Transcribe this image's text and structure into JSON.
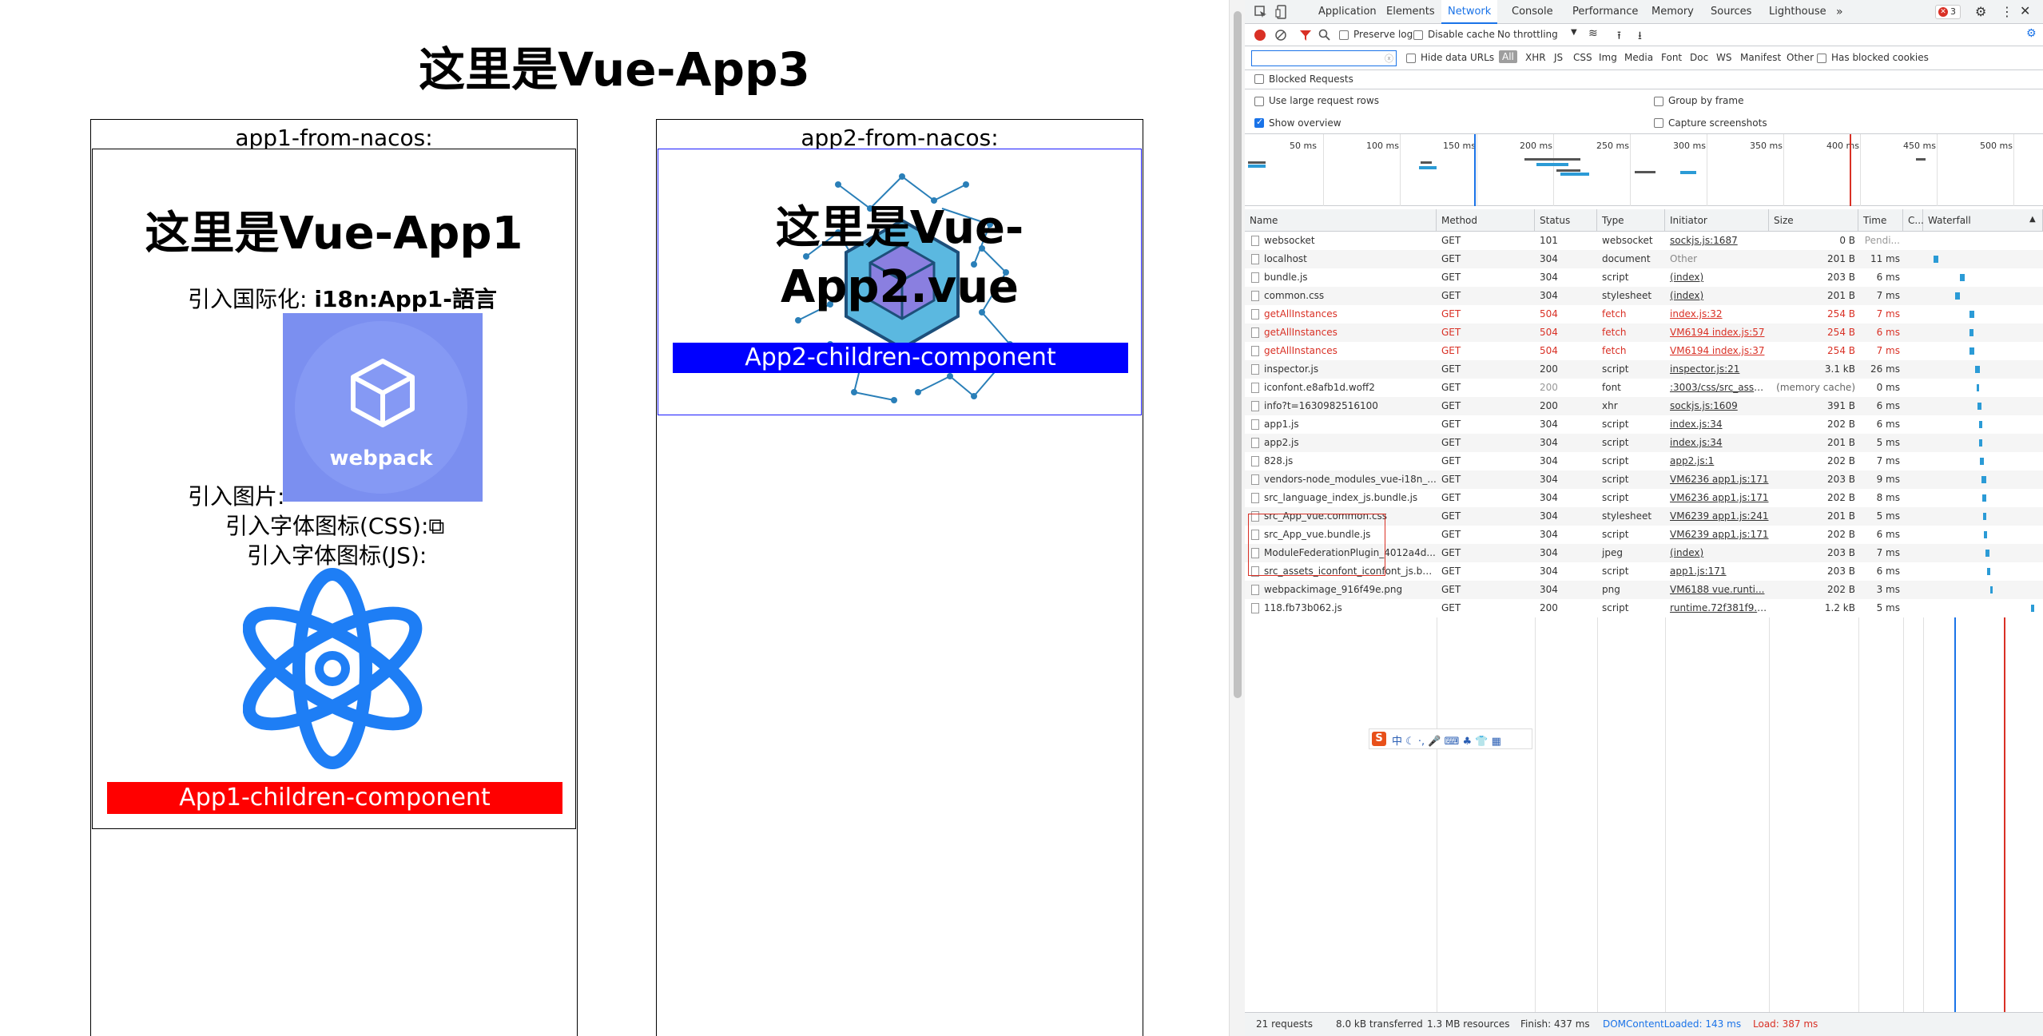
{
  "page": {
    "title": "这里是Vue-App3",
    "app1_panel_label": "app1-from-nacos:",
    "app2_panel_label": "app2-from-nacos:",
    "app1": {
      "title": "这里是Vue-App1",
      "i18n_label": "引入国际化: ",
      "i18n_value": "i18n:App1-語言",
      "image_label": "引入图片:",
      "webpack_text": "webpack",
      "font_css_label": "引入字体图标(CSS):",
      "font_css_glyph": "⧉",
      "font_js_label": "引入字体图标(JS):",
      "child_component": "App1-children-component",
      "child_color": "#ff0000"
    },
    "app2": {
      "title_line1": "这里是Vue-",
      "title_line2": "App2.vue",
      "child_component": "App2-children-component",
      "child_color": "#0000ff"
    }
  },
  "devtools": {
    "tabs": [
      "Application",
      "Elements",
      "Network",
      "Console",
      "Performance",
      "Memory",
      "Sources",
      "Lighthouse"
    ],
    "active_tab": "Network",
    "error_count": "3",
    "toolbar": {
      "preserve_log": "Preserve log",
      "disable_cache": "Disable cache",
      "throttling": "No throttling"
    },
    "filter": {
      "placeholder": "",
      "hide_data_urls": "Hide data URLs",
      "types": [
        "All",
        "XHR",
        "JS",
        "CSS",
        "Img",
        "Media",
        "Font",
        "Doc",
        "WS",
        "Manifest",
        "Other"
      ],
      "has_blocked_cookies": "Has blocked cookies"
    },
    "options": {
      "blocked_requests": "Blocked Requests",
      "large_rows": "Use large request rows",
      "group_by_frame": "Group by frame",
      "show_overview": "Show overview",
      "capture_screenshots": "Capture screenshots"
    },
    "timeline_ticks": [
      "50 ms",
      "100 ms",
      "150 ms",
      "200 ms",
      "250 ms",
      "300 ms",
      "350 ms",
      "400 ms",
      "450 ms",
      "500 ms"
    ],
    "columns": [
      "Name",
      "Method",
      "Status",
      "Type",
      "Initiator",
      "Size",
      "Time",
      "C...",
      "Waterfall"
    ],
    "requests": [
      {
        "name": "websocket",
        "method": "GET",
        "status": "101",
        "type": "websocket",
        "initiator": "sockjs.js:1687",
        "size": "0 B",
        "time": "Pendi...",
        "error": false
      },
      {
        "name": "localhost",
        "method": "GET",
        "status": "304",
        "type": "document",
        "initiator": "Other",
        "size": "201 B",
        "time": "11 ms",
        "error": false
      },
      {
        "name": "bundle.js",
        "method": "GET",
        "status": "304",
        "type": "script",
        "initiator": "(index)",
        "size": "203 B",
        "time": "6 ms",
        "error": false
      },
      {
        "name": "common.css",
        "method": "GET",
        "status": "304",
        "type": "stylesheet",
        "initiator": "(index)",
        "size": "201 B",
        "time": "7 ms",
        "error": false
      },
      {
        "name": "getAllInstances",
        "method": "GET",
        "status": "504",
        "type": "fetch",
        "initiator": "index.js:32",
        "size": "254 B",
        "time": "7 ms",
        "error": true
      },
      {
        "name": "getAllInstances",
        "method": "GET",
        "status": "504",
        "type": "fetch",
        "initiator": "VM6194 index.js:57",
        "size": "254 B",
        "time": "6 ms",
        "error": true
      },
      {
        "name": "getAllInstances",
        "method": "GET",
        "status": "504",
        "type": "fetch",
        "initiator": "VM6194 index.js:37",
        "size": "254 B",
        "time": "7 ms",
        "error": true
      },
      {
        "name": "inspector.js",
        "method": "GET",
        "status": "200",
        "type": "script",
        "initiator": "inspector.js:21",
        "size": "3.1 kB",
        "time": "26 ms",
        "error": false
      },
      {
        "name": "iconfont.e8afb1d.woff2",
        "method": "GET",
        "status": "200",
        "type": "font",
        "initiator": ":3003/css/src_asset...",
        "size": "(memory cache)",
        "time": "0 ms",
        "error": false
      },
      {
        "name": "info?t=1630982516100",
        "method": "GET",
        "status": "200",
        "type": "xhr",
        "initiator": "sockjs.js:1609",
        "size": "391 B",
        "time": "6 ms",
        "error": false
      },
      {
        "name": "app1.js",
        "method": "GET",
        "status": "304",
        "type": "script",
        "initiator": "index.js:34",
        "size": "202 B",
        "time": "6 ms",
        "error": false
      },
      {
        "name": "app2.js",
        "method": "GET",
        "status": "304",
        "type": "script",
        "initiator": "index.js:34",
        "size": "201 B",
        "time": "5 ms",
        "error": false
      },
      {
        "name": "828.js",
        "method": "GET",
        "status": "304",
        "type": "script",
        "initiator": "app2.js:1",
        "size": "202 B",
        "time": "7 ms",
        "error": false
      },
      {
        "name": "vendors-node_modules_vue-i18n_...",
        "method": "GET",
        "status": "304",
        "type": "script",
        "initiator": "VM6236 app1.js:171",
        "size": "203 B",
        "time": "9 ms",
        "error": false
      },
      {
        "name": "src_language_index_js.bundle.js",
        "method": "GET",
        "status": "304",
        "type": "script",
        "initiator": "VM6236 app1.js:171",
        "size": "202 B",
        "time": "8 ms",
        "error": false
      },
      {
        "name": "src_App_vue.common.css",
        "method": "GET",
        "status": "304",
        "type": "stylesheet",
        "initiator": "VM6239 app1.js:241",
        "size": "201 B",
        "time": "5 ms",
        "error": false
      },
      {
        "name": "src_App_vue.bundle.js",
        "method": "GET",
        "status": "304",
        "type": "script",
        "initiator": "VM6239 app1.js:171",
        "size": "202 B",
        "time": "6 ms",
        "error": false
      },
      {
        "name": "ModuleFederationPlugin_4012a4d...",
        "method": "GET",
        "status": "304",
        "type": "jpeg",
        "initiator": "(index)",
        "size": "203 B",
        "time": "7 ms",
        "error": false
      },
      {
        "name": "src_assets_iconfont_iconfont_js.bu...",
        "method": "GET",
        "status": "304",
        "type": "script",
        "initiator": "app1.js:171",
        "size": "203 B",
        "time": "6 ms",
        "error": false
      },
      {
        "name": "webpackimage_916f49e.png",
        "method": "GET",
        "status": "304",
        "type": "png",
        "initiator": "VM6188 vue.runti...",
        "size": "202 B",
        "time": "3 ms",
        "error": false
      },
      {
        "name": "118.fb73b062.js",
        "method": "GET",
        "status": "200",
        "type": "script",
        "initiator": "runtime.72f381f9.js:1",
        "size": "1.2 kB",
        "time": "5 ms",
        "error": false
      }
    ],
    "status_bar": {
      "requests": "21 requests",
      "transferred": "8.0 kB transferred",
      "resources": "1.3 MB resources",
      "finish": "Finish: 437 ms",
      "dom_content_loaded": "DOMContentLoaded: 143 ms",
      "load": "Load: 387 ms"
    },
    "colors": {
      "accent": "#1a73e8",
      "error": "#d93025",
      "dcl": "#1a73e8",
      "load": "#d93025"
    }
  }
}
